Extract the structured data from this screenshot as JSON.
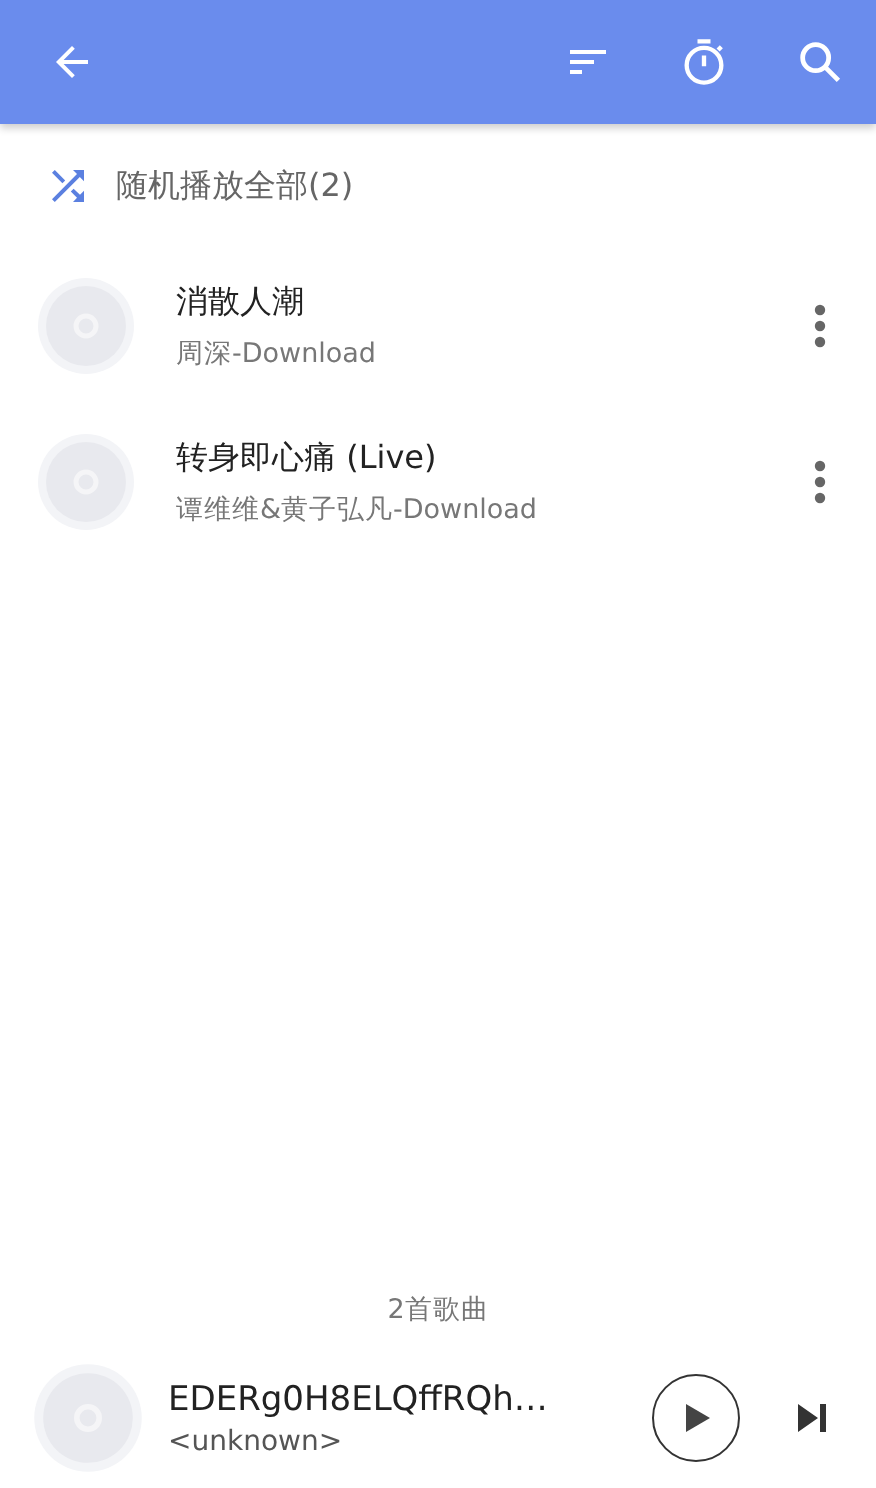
{
  "shuffle": {
    "label": "随机播放全部(2)"
  },
  "songs": [
    {
      "title": "消散人潮",
      "subtitle": "周深-Download"
    },
    {
      "title": "转身即心痛 (Live)",
      "subtitle": "谭维维&黄子弘凡-Download"
    }
  ],
  "song_count": "2首歌曲",
  "now_playing": {
    "title": "EDERg0H8ELQffRQh…",
    "artist": "<unknown>",
    "playing": false
  }
}
